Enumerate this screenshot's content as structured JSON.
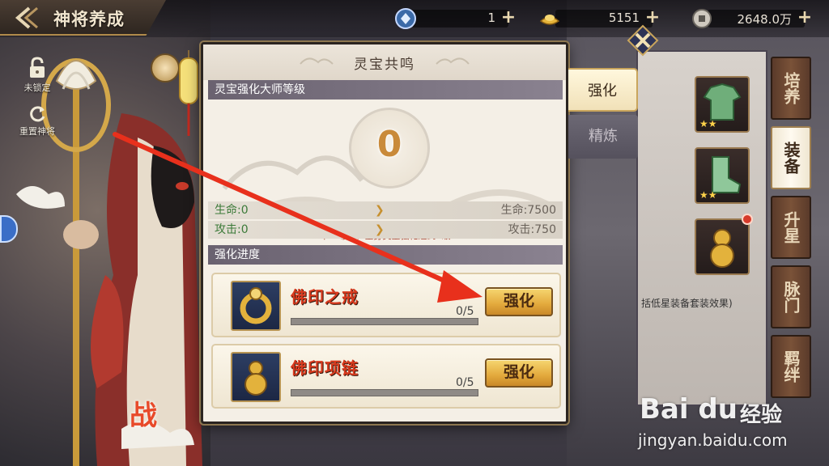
{
  "header": {
    "title": "神将养成",
    "resources": [
      {
        "icon": "vip-badge-icon",
        "value": "1"
      },
      {
        "icon": "gold-ingot-icon",
        "value": "5151"
      },
      {
        "icon": "copper-coin-icon",
        "value": "2648.0万"
      }
    ]
  },
  "left_controls": {
    "lock_label": "未锁定",
    "reset_label": "重置神将"
  },
  "right_tabs": [
    "培养",
    "装备",
    "升星",
    "脉门",
    "羁绊"
  ],
  "right_tabs_active": "装备",
  "right_panel": {
    "suit_note": "括低星装备套装效果)"
  },
  "modal": {
    "title": "灵宝共鸣",
    "side_tabs": [
      {
        "label": "强化",
        "active": true
      },
      {
        "label": "精炼",
        "active": false
      }
    ],
    "master_section": "灵宝强化大师等级",
    "level": "0",
    "next_level_text": "下一等级：全身灵宝强化达到5级",
    "stats": [
      {
        "current": "生命:0",
        "next": "生命:7500"
      },
      {
        "current": "攻击:0",
        "next": "攻击:750"
      }
    ],
    "progress_section": "强化进度",
    "items": [
      {
        "name": "佛印之戒",
        "progress": "0/5",
        "progress_fraction": 0,
        "button": "强化"
      },
      {
        "name": "佛印项链",
        "progress": "0/5",
        "progress_fraction": 0,
        "button": "强化"
      }
    ]
  },
  "watermark": {
    "logo": "Bai du",
    "sub": "经验",
    "url": "jingyan.baidu.com"
  },
  "colors": {
    "item_name": "#d83a1e",
    "stat_current": "#3b7a38",
    "button_gold": "#e3a93c",
    "arrow_red": "#e8301c"
  }
}
